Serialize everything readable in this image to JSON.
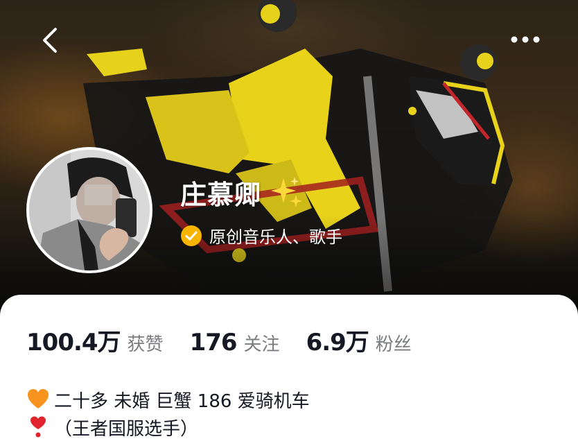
{
  "profile": {
    "name": "庄慕卿",
    "verification": "原创音乐人、歌手"
  },
  "stats": [
    {
      "value": "100.4万",
      "label": "获赞"
    },
    {
      "value": "176",
      "label": "关注"
    },
    {
      "value": "6.9万",
      "label": "粉丝"
    }
  ],
  "bio": {
    "line1": "二十多 未婚 巨蟹 186 爱骑机车",
    "line2": "（王者国服选手）"
  },
  "icons": {
    "back": "chevron-left-icon",
    "more": "more-horizontal-icon",
    "verified": "verified-check-icon",
    "sparkle": "sparkles-icon",
    "heart1": "orange-heart-icon",
    "heart2": "heart-exclamation-icon"
  },
  "colors": {
    "verified_badge": "#f7b500",
    "stat_label": "#7b7c80",
    "primary_text": "#161823"
  }
}
